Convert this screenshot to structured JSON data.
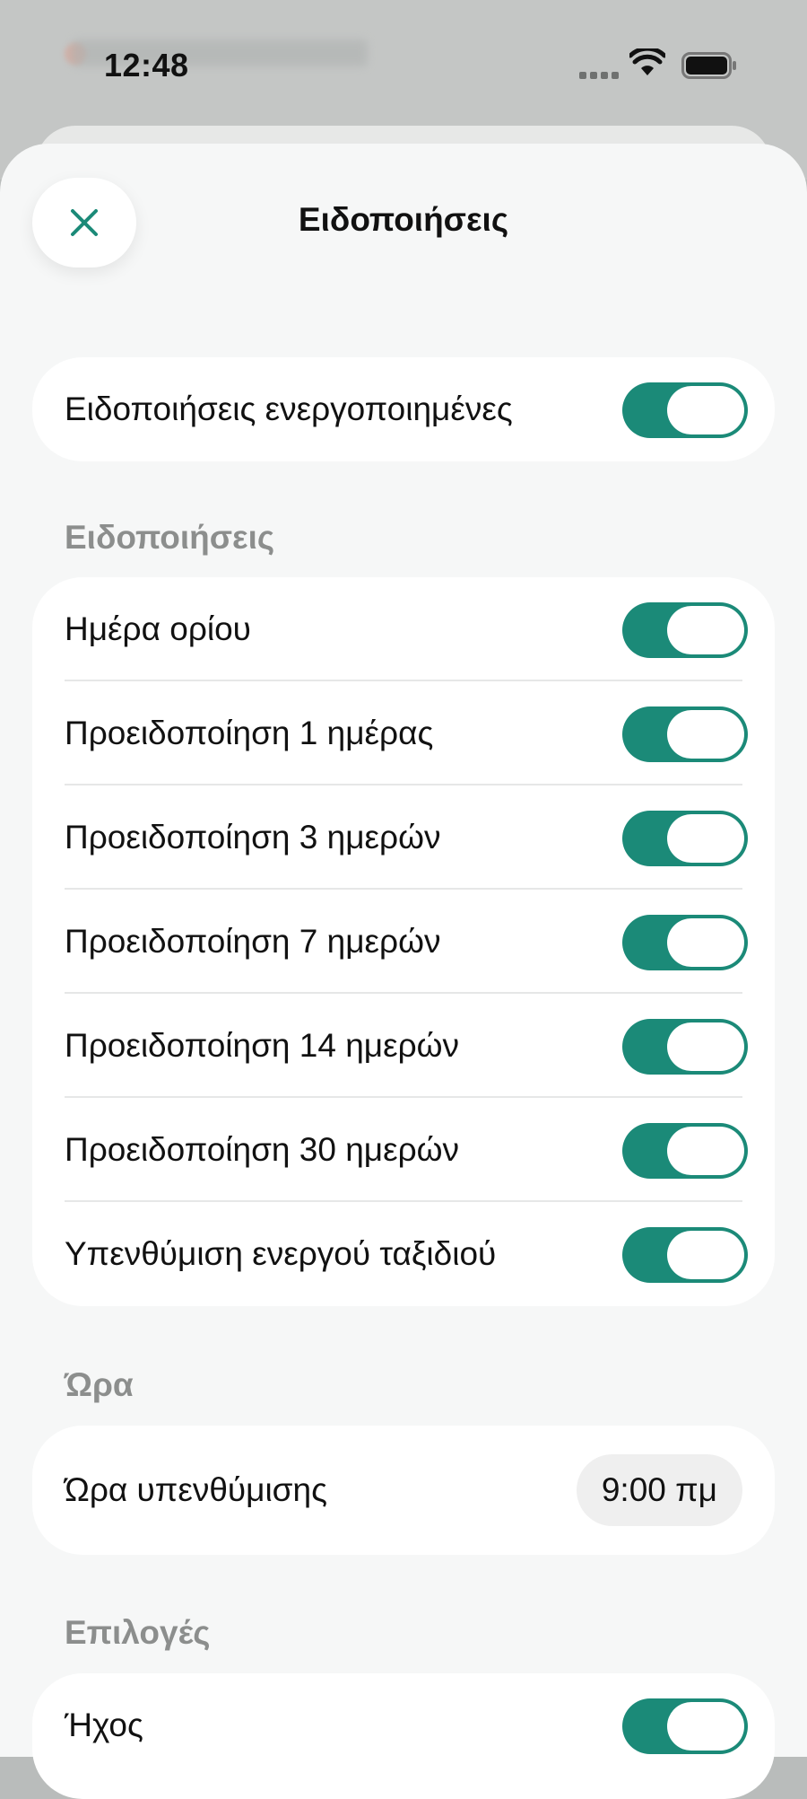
{
  "status_bar": {
    "time": "12:48"
  },
  "header": {
    "title": "Ειδοποιήσεις"
  },
  "master": {
    "label": "Ειδοποιήσεις ενεργοποιημένες",
    "on": true
  },
  "notifications": {
    "header": "Ειδοποιήσεις",
    "items": [
      {
        "label": "Ημέρα ορίου",
        "on": true
      },
      {
        "label": "Προειδοποίηση 1 ημέρας",
        "on": true
      },
      {
        "label": "Προειδοποίηση 3 ημερών",
        "on": true
      },
      {
        "label": "Προειδοποίηση 7 ημερών",
        "on": true
      },
      {
        "label": "Προειδοποίηση 14 ημερών",
        "on": true
      },
      {
        "label": "Προειδοποίηση 30 ημερών",
        "on": true
      },
      {
        "label": "Υπενθύμιση ενεργού ταξιδιού",
        "on": true
      }
    ]
  },
  "time": {
    "header": "Ώρα",
    "label": "Ώρα υπενθύμισης",
    "value": "9:00 πμ"
  },
  "options": {
    "header": "Επιλογές",
    "items": [
      {
        "label": "Ήχος",
        "on": true
      }
    ]
  },
  "colors": {
    "accent": "#1b8a78",
    "background": "#f6f7f7",
    "card": "#ffffff",
    "section_header": "#8c8e8d"
  }
}
